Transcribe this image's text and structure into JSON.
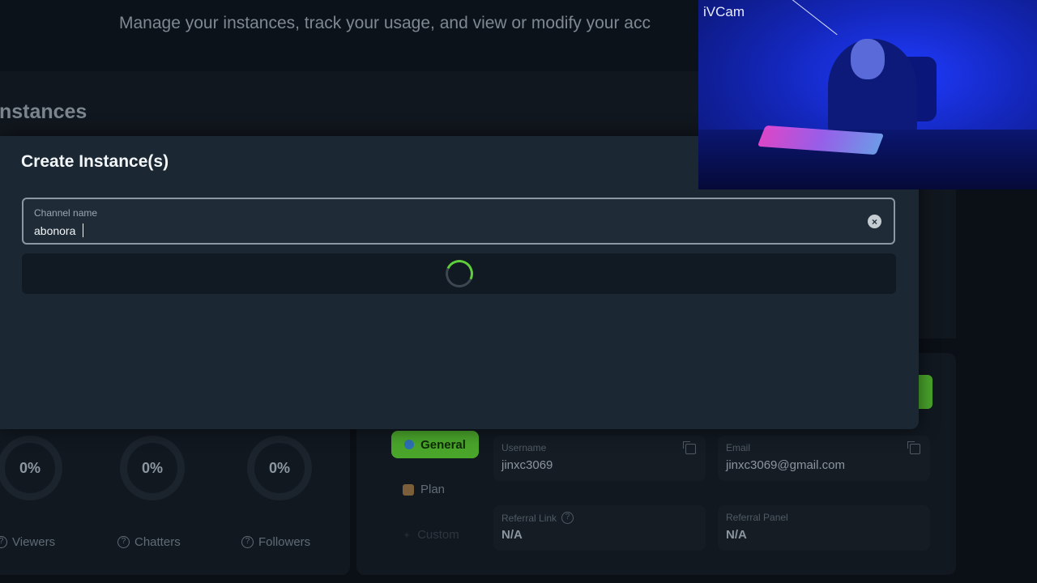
{
  "background": {
    "subtitle": "Manage your instances, track your usage, and view or modify your acc",
    "section_title": "Instances",
    "stats": [
      {
        "value": "0%",
        "label": "Viewers"
      },
      {
        "value": "0%",
        "label": "Chatters"
      },
      {
        "value": "0%",
        "label": "Followers"
      }
    ],
    "account_tabs": {
      "general": "General",
      "plan": "Plan",
      "custom": "Custom"
    },
    "account_fields": {
      "username_label": "Username",
      "username_value": "jinxc3069",
      "email_label": "Email",
      "email_value": "jinxc3069@gmail.com",
      "referral_link_label": "Referral Link",
      "referral_link_value": "N/A",
      "referral_panel_label": "Referral Panel",
      "referral_panel_value": "N/A"
    }
  },
  "modal": {
    "title": "Create Instance(s)",
    "channel_input": {
      "label": "Channel name",
      "value": "abonora"
    }
  },
  "webcam": {
    "label": "iVCam"
  },
  "colors": {
    "accent_green": "#4aa52b",
    "modal_bg": "#1b2833",
    "page_bg": "#0b1016"
  }
}
